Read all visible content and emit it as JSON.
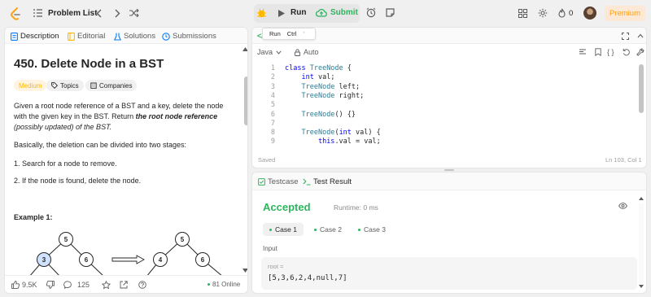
{
  "topnav": {
    "problem_list_label": "Problem List",
    "run_label": "Run",
    "submit_label": "Submit",
    "streak_count": "0",
    "premium_label": "Premium"
  },
  "left_tabs": [
    "Description",
    "Editorial",
    "Solutions",
    "Submissions"
  ],
  "problem": {
    "title": "450. Delete Node in a BST",
    "difficulty": "Medium",
    "topics_label": "Topics",
    "companies_label": "Companies",
    "desc_p1_a": "Given a root node reference of a BST and a key, delete the node with the given key in the BST. Return ",
    "desc_p1_bold": "the root node reference",
    "desc_p1_c": " (possibly updated) of the BST.",
    "desc_p2": "Basically, the deletion can be divided into two stages:",
    "step1": "1. Search for a node to remove.",
    "step2": "2. If the node is found, delete the node.",
    "example_heading": "Example 1:",
    "tree_left_nodes": [
      "5",
      "3",
      "6"
    ],
    "tree_right_nodes": [
      "5",
      "4",
      "6"
    ]
  },
  "bottom_bar": {
    "likes": "9.5K",
    "comments": "125",
    "online": "81 Online"
  },
  "editor": {
    "language": "Java",
    "mode": "Auto",
    "tooltip_run": "Run",
    "tooltip_shortcut": "Ctrl",
    "saved_label": "Saved",
    "cursor_pos": "Ln 103, Col 1",
    "lines": [
      {
        "n": "1",
        "text": "class TreeNode {"
      },
      {
        "n": "2",
        "text": "    int val;"
      },
      {
        "n": "3",
        "text": "    TreeNode left;"
      },
      {
        "n": "4",
        "text": "    TreeNode right;"
      },
      {
        "n": "5",
        "text": ""
      },
      {
        "n": "6",
        "text": "    TreeNode() {}"
      },
      {
        "n": "7",
        "text": ""
      },
      {
        "n": "8",
        "text": "    TreeNode(int val) {"
      },
      {
        "n": "9",
        "text": "        this.val = val;"
      }
    ]
  },
  "result": {
    "tab_testcase": "Testcase",
    "tab_result": "Test Result",
    "status": "Accepted",
    "runtime": "Runtime: 0 ms",
    "cases": [
      "Case 1",
      "Case 2",
      "Case 3"
    ],
    "input_label": "Input",
    "var_name": "root =",
    "var_value": "[5,3,6,2,4,null,7]"
  },
  "colors": {
    "accepted": "#2db55d",
    "premium": "#ffa116",
    "medium": "#ffb800",
    "active_tab": "#007bff"
  }
}
